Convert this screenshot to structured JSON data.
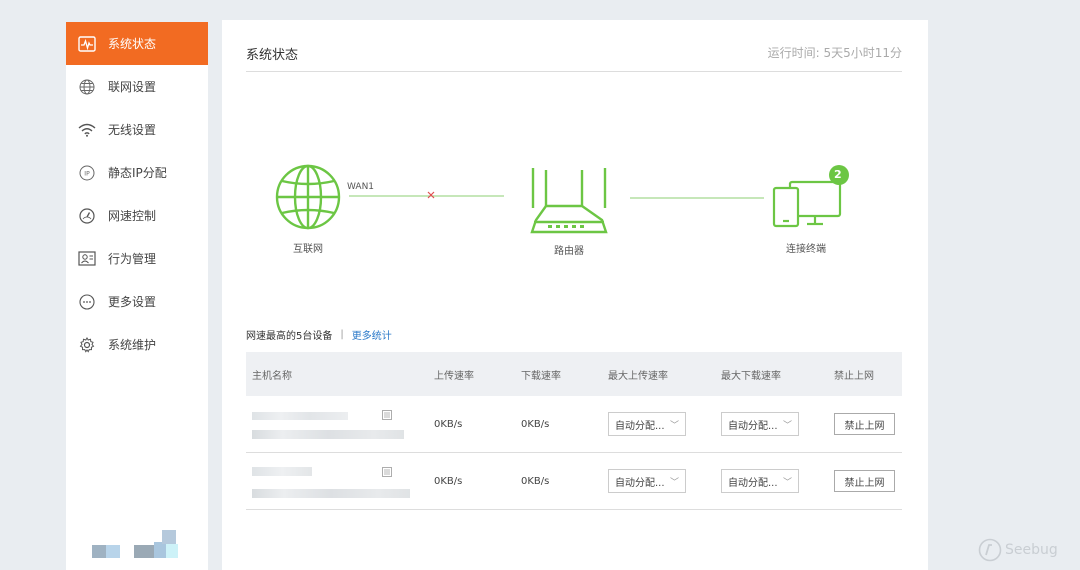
{
  "sidebar": {
    "items": [
      {
        "label": "系统状态",
        "icon": "pulse-icon",
        "active": true
      },
      {
        "label": "联网设置",
        "icon": "globe-icon"
      },
      {
        "label": "无线设置",
        "icon": "wifi-icon"
      },
      {
        "label": "静态IP分配",
        "icon": "ip-icon"
      },
      {
        "label": "网速控制",
        "icon": "speedometer-icon"
      },
      {
        "label": "行为管理",
        "icon": "user-card-icon"
      },
      {
        "label": "更多设置",
        "icon": "more-dots-icon"
      },
      {
        "label": "系统维护",
        "icon": "gear-icon"
      }
    ]
  },
  "header": {
    "title": "系统状态",
    "uptime": "运行时间:  5天5小时11分"
  },
  "topology": {
    "internet_label": "互联网",
    "wan_label": "WAN1",
    "router_label": "路由器",
    "clients_label": "连接终端",
    "client_count": "2",
    "accent": "#6cc644",
    "error_color": "#e05050"
  },
  "stats": {
    "title": "网速最高的5台设备",
    "separator": "|",
    "more_link": "更多统计"
  },
  "table": {
    "columns": [
      "主机名称",
      "上传速率",
      "下载速率",
      "最大上传速率",
      "最大下载速率",
      "禁止上网"
    ],
    "rows": [
      {
        "upload": "0KB/s",
        "download": "0KB/s",
        "max_up": "自动分配...",
        "max_down": "自动分配...",
        "ban": "禁止上网"
      },
      {
        "upload": "0KB/s",
        "download": "0KB/s",
        "max_up": "自动分配...",
        "max_down": "自动分配...",
        "ban": "禁止上网"
      }
    ]
  },
  "watermark": "Seebug",
  "colors": {
    "brand": "#f26b22",
    "link": "#2a78c8"
  }
}
